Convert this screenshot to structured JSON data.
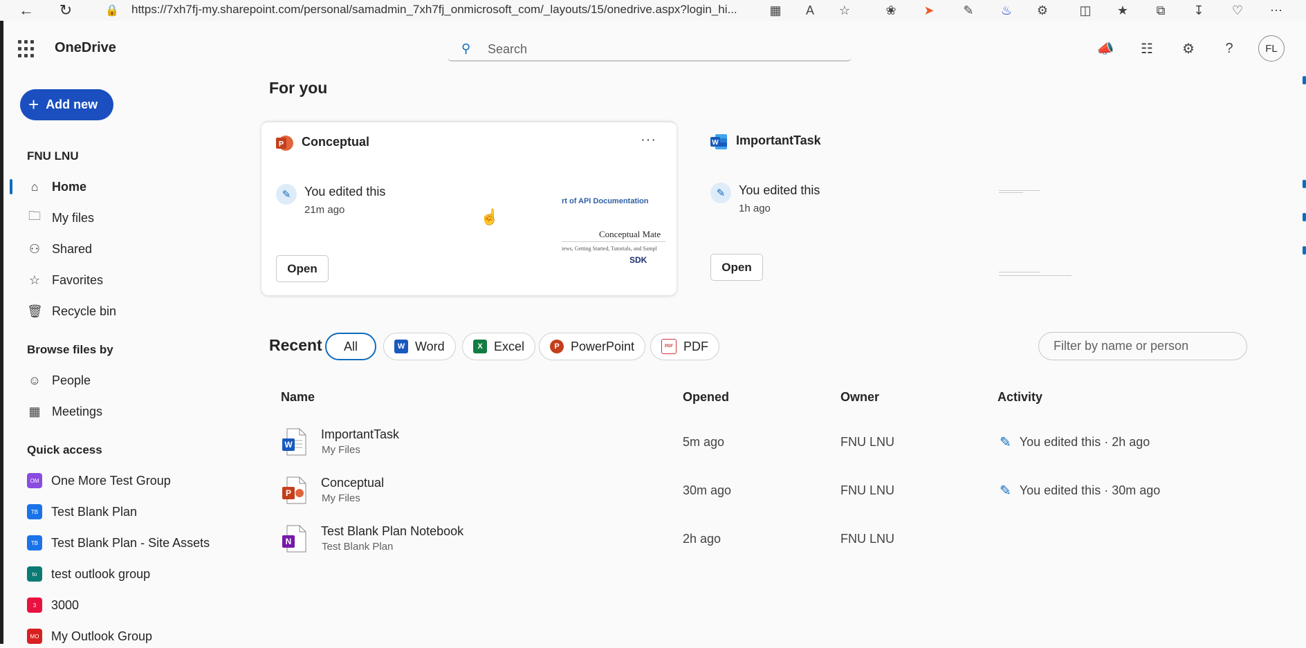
{
  "browser": {
    "url": "https://7xh7fj-my.sharepoint.com/personal/samadmin_7xh7fj_onmicrosoft_com/_layouts/15/onedrive.aspx?login_hi..."
  },
  "app": {
    "title": "OneDrive",
    "search_placeholder": "Search",
    "avatar_initials": "FL"
  },
  "sidebar": {
    "add_new": "Add new",
    "user_name": "FNU LNU",
    "items": [
      {
        "label": "Home",
        "icon": "home-icon"
      },
      {
        "label": "My files",
        "icon": "folder-icon"
      },
      {
        "label": "Shared",
        "icon": "people-icon"
      },
      {
        "label": "Favorites",
        "icon": "star-icon"
      },
      {
        "label": "Recycle bin",
        "icon": "trash-icon"
      }
    ],
    "browse_title": "Browse files by",
    "browse_items": [
      {
        "label": "People",
        "icon": "person-icon"
      },
      {
        "label": "Meetings",
        "icon": "calendar-icon"
      }
    ],
    "quick_access_title": "Quick access",
    "quick_access": [
      {
        "label": "One More Test Group",
        "badge": "OM",
        "color": "#8a4be0"
      },
      {
        "label": "Test Blank Plan",
        "badge": "TB",
        "color": "#1a73e8"
      },
      {
        "label": "Test Blank Plan - Site Assets",
        "badge": "TB",
        "color": "#1a73e8"
      },
      {
        "label": "test outlook group",
        "badge": "to",
        "color": "#0b7a75"
      },
      {
        "label": "3000",
        "badge": "3",
        "color": "#e8113f"
      },
      {
        "label": "My Outlook Group",
        "badge": "MO",
        "color": "#d92020"
      }
    ]
  },
  "for_you": {
    "title": "For you",
    "cards": [
      {
        "title": "Conceptual",
        "type": "powerpoint",
        "activity": "You edited this",
        "time": "21m ago",
        "open_label": "Open",
        "more_label": "···",
        "thumb_title": "rt of API Documentation",
        "thumb_heading": "Conceptual Mate",
        "thumb_sub": "iews, Getting Started, Tutorials, and Sampl",
        "thumb_logo": "SDK"
      },
      {
        "title": "ImportantTask",
        "type": "word",
        "activity": "You edited this",
        "time": "1h ago",
        "open_label": "Open"
      }
    ]
  },
  "recent": {
    "title": "Recent",
    "filters": [
      {
        "label": "All",
        "active": true
      },
      {
        "label": "Word",
        "color": "#185abd",
        "letter": "W"
      },
      {
        "label": "Excel",
        "color": "#107c41",
        "letter": "X"
      },
      {
        "label": "PowerPoint",
        "color": "#c43e1c",
        "letter": "P"
      },
      {
        "label": "PDF",
        "color": "#d13438",
        "letter": "PDF"
      }
    ],
    "filter_placeholder": "Filter by name or person",
    "columns": [
      "Name",
      "Opened",
      "Owner",
      "Activity"
    ],
    "rows": [
      {
        "name": "ImportantTask",
        "location": "My Files",
        "opened": "5m ago",
        "owner": "FNU LNU",
        "activity": "You edited this · 2h ago",
        "type": "word"
      },
      {
        "name": "Conceptual",
        "location": "My Files",
        "opened": "30m ago",
        "owner": "FNU LNU",
        "activity": "You edited this · 30m ago",
        "type": "powerpoint"
      },
      {
        "name": "Test Blank Plan Notebook",
        "location": "Test Blank Plan",
        "opened": "2h ago",
        "owner": "FNU LNU",
        "activity": "",
        "type": "onenote"
      }
    ]
  },
  "colors": {
    "accent": "#0f6cbd",
    "add_new_bg": "#1b4fbf"
  }
}
